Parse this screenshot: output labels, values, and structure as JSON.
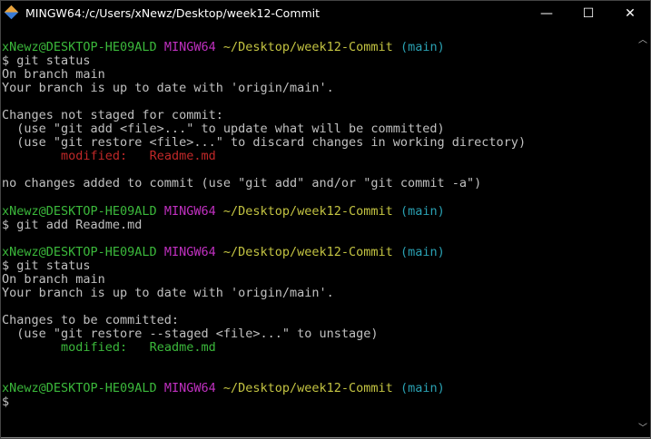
{
  "window": {
    "title": "MINGW64:/c/Users/xNewz/Desktop/week12-Commit",
    "minimize_label": "—",
    "maximize_label": "☐",
    "close_label": "✕"
  },
  "colors": {
    "green": "#3bb83b",
    "magenta": "#c030c0",
    "yellow": "#c4c442",
    "cyan": "#2aa1b3",
    "red": "#c02828",
    "white": "#c0c0c0"
  },
  "terminal": {
    "lines": [
      [
        [
          "xNewz@DESKTOP-HE09ALD",
          "green"
        ],
        [
          " ",
          "white"
        ],
        [
          "MINGW64",
          "magenta"
        ],
        [
          " ",
          "white"
        ],
        [
          "~/Desktop/week12-Commit",
          "yellow"
        ],
        [
          " ",
          "white"
        ],
        [
          "(main)",
          "cyan"
        ]
      ],
      [
        [
          "$ git status",
          "white"
        ]
      ],
      [
        [
          "On branch main",
          "white"
        ]
      ],
      [
        [
          "Your branch is up to date with 'origin/main'.",
          "white"
        ]
      ],
      [],
      [
        [
          "Changes not staged for commit:",
          "white"
        ]
      ],
      [
        [
          "  (use \"git add <file>...\" to update what will be committed)",
          "white"
        ]
      ],
      [
        [
          "  (use \"git restore <file>...\" to discard changes in working directory)",
          "white"
        ]
      ],
      [
        [
          "        ",
          "white"
        ],
        [
          "modified:   Readme.md",
          "red"
        ]
      ],
      [],
      [
        [
          "no changes added to commit (use \"git add\" and/or \"git commit -a\")",
          "white"
        ]
      ],
      [],
      [
        [
          "xNewz@DESKTOP-HE09ALD",
          "green"
        ],
        [
          " ",
          "white"
        ],
        [
          "MINGW64",
          "magenta"
        ],
        [
          " ",
          "white"
        ],
        [
          "~/Desktop/week12-Commit",
          "yellow"
        ],
        [
          " ",
          "white"
        ],
        [
          "(main)",
          "cyan"
        ]
      ],
      [
        [
          "$ git add Readme.md",
          "white"
        ]
      ],
      [],
      [
        [
          "xNewz@DESKTOP-HE09ALD",
          "green"
        ],
        [
          " ",
          "white"
        ],
        [
          "MINGW64",
          "magenta"
        ],
        [
          " ",
          "white"
        ],
        [
          "~/Desktop/week12-Commit",
          "yellow"
        ],
        [
          " ",
          "white"
        ],
        [
          "(main)",
          "cyan"
        ]
      ],
      [
        [
          "$ git status",
          "white"
        ]
      ],
      [
        [
          "On branch main",
          "white"
        ]
      ],
      [
        [
          "Your branch is up to date with 'origin/main'.",
          "white"
        ]
      ],
      [],
      [
        [
          "Changes to be committed:",
          "white"
        ]
      ],
      [
        [
          "  (use \"git restore --staged <file>...\" to unstage)",
          "white"
        ]
      ],
      [
        [
          "        ",
          "white"
        ],
        [
          "modified:   Readme.md",
          "green"
        ]
      ],
      [],
      [],
      [
        [
          "xNewz@DESKTOP-HE09ALD",
          "green"
        ],
        [
          " ",
          "white"
        ],
        [
          "MINGW64",
          "magenta"
        ],
        [
          " ",
          "white"
        ],
        [
          "~/Desktop/week12-Commit",
          "yellow"
        ],
        [
          " ",
          "white"
        ],
        [
          "(main)",
          "cyan"
        ]
      ],
      [
        [
          "$",
          "white"
        ]
      ]
    ]
  },
  "scrollbar": {
    "up_label": "︿",
    "down_label": "﹀"
  }
}
